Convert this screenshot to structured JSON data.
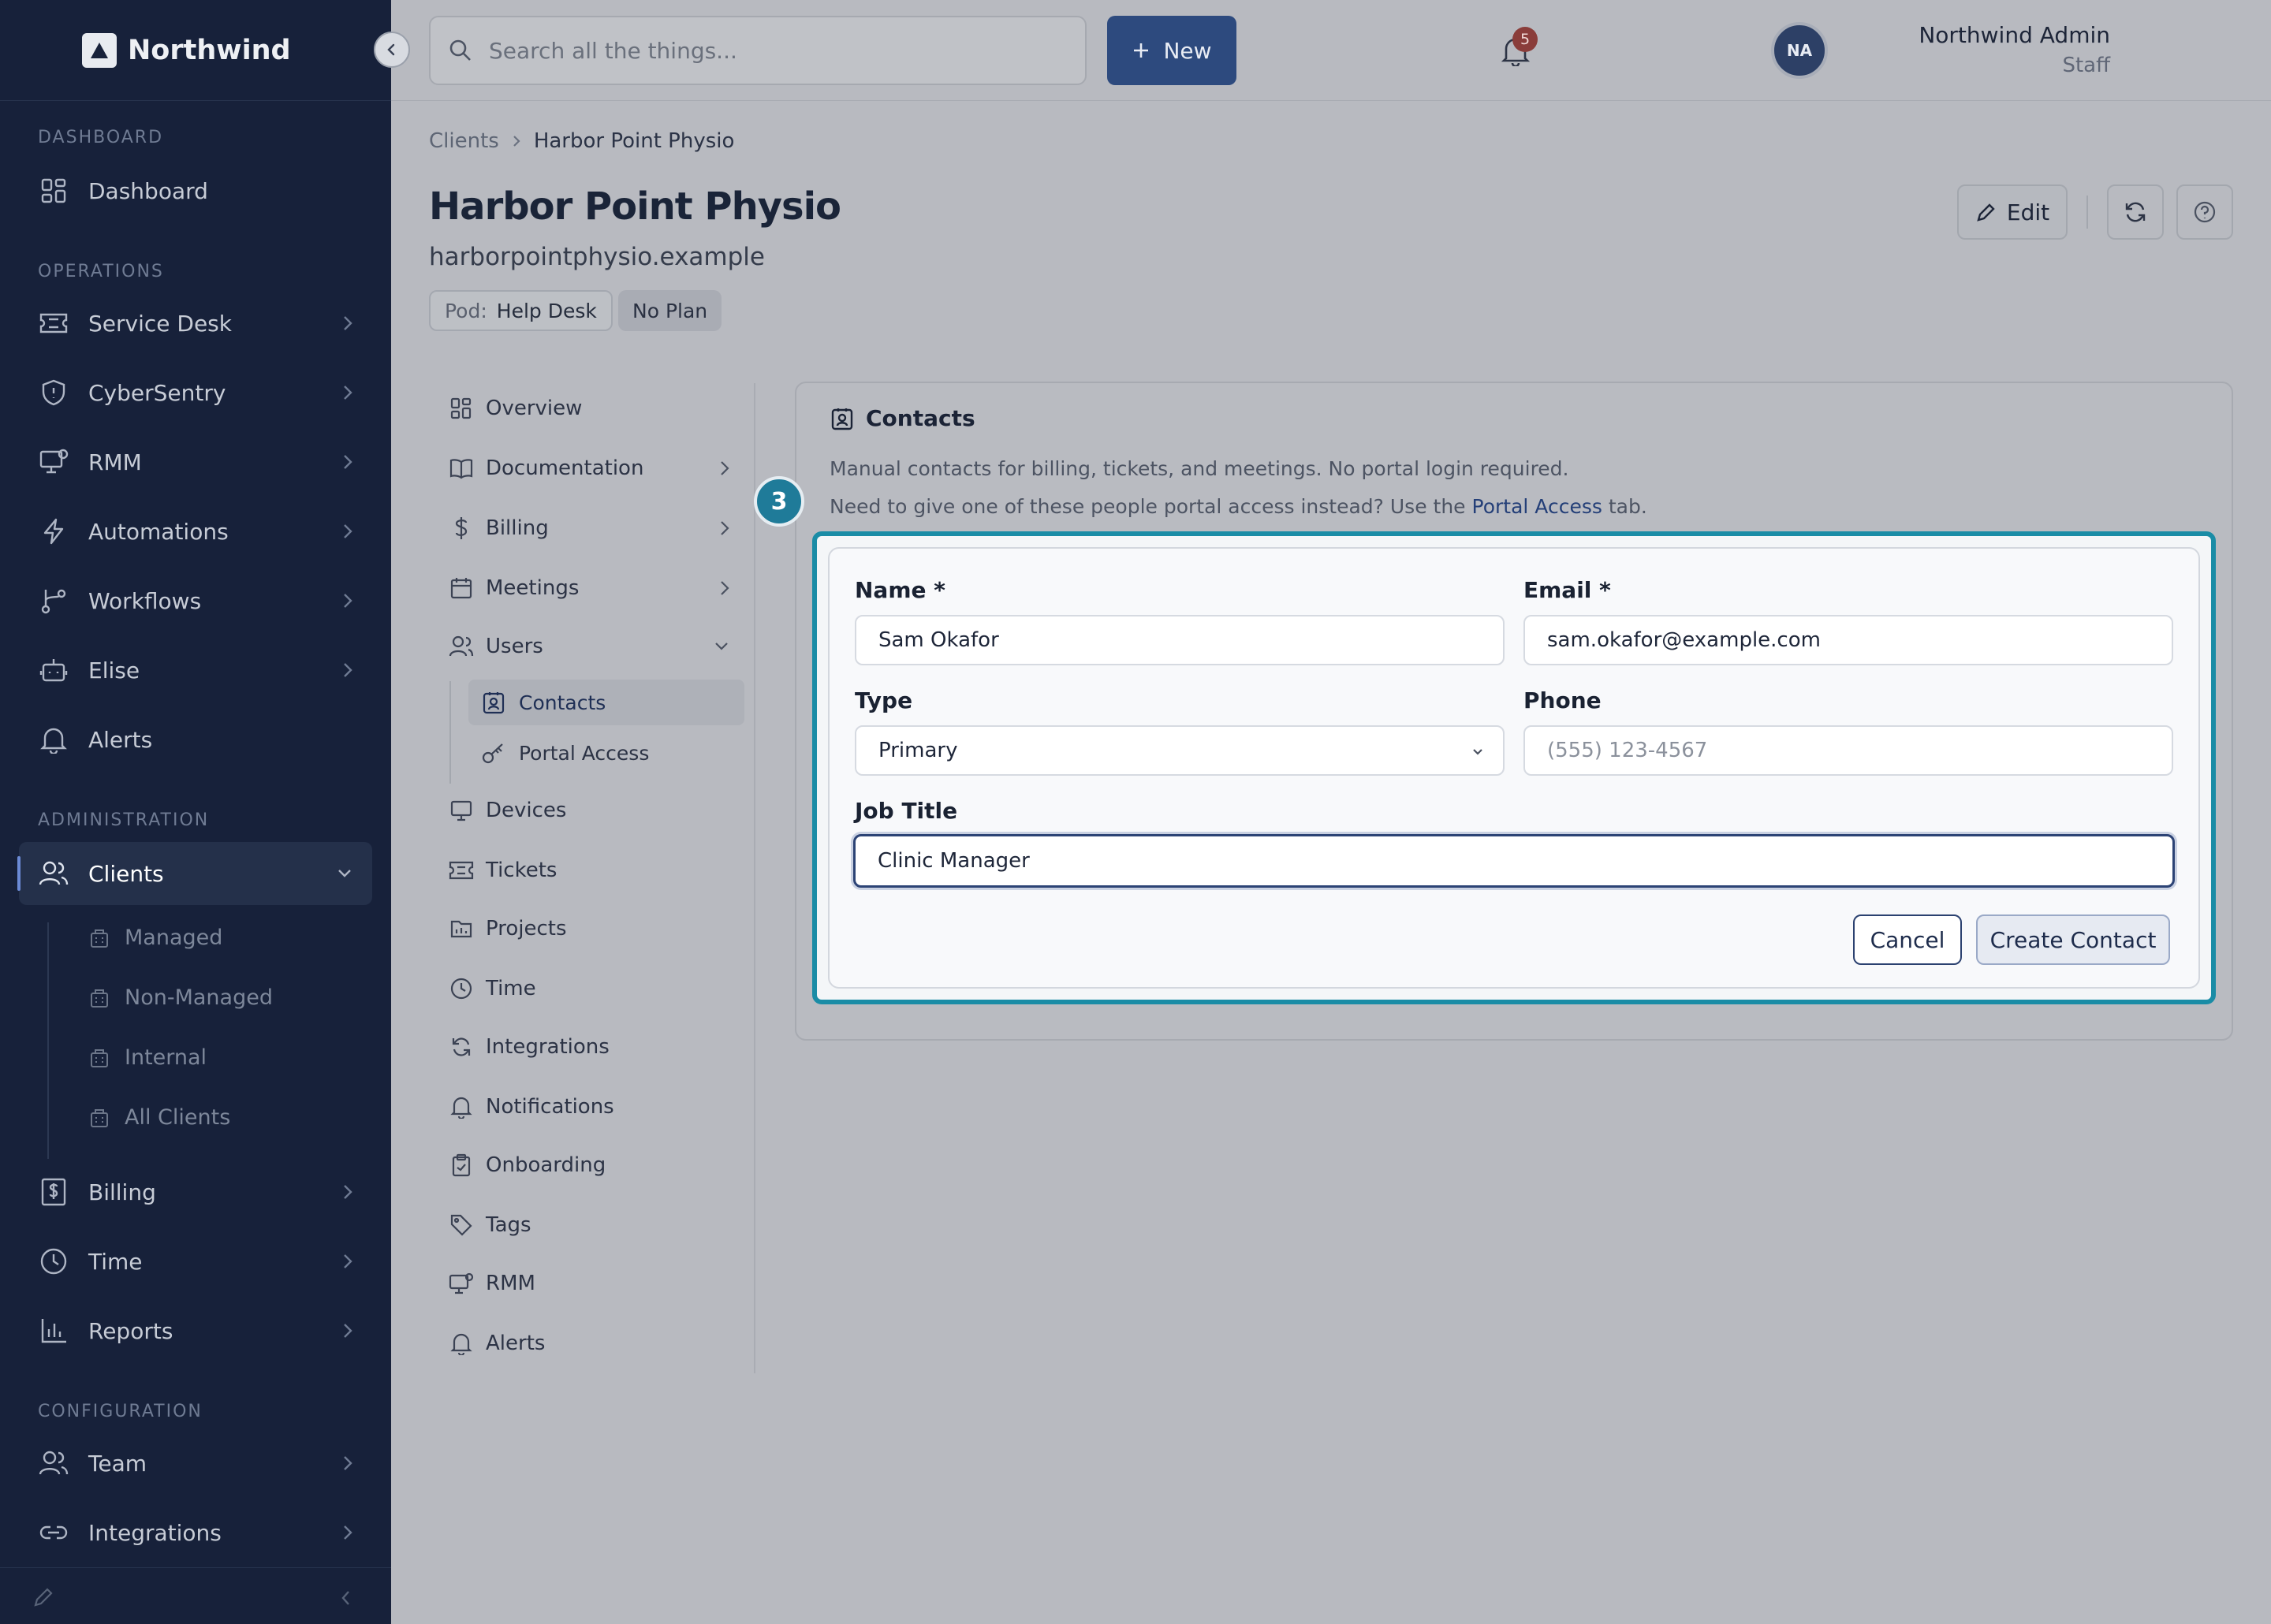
{
  "sidebar": {
    "brand": "Northwind",
    "sections": {
      "dashboard": "DASHBOARD",
      "operations": "OPERATIONS",
      "administration": "ADMINISTRATION",
      "configuration": "CONFIGURATION"
    },
    "items": {
      "dashboard": "Dashboard",
      "service_desk": "Service Desk",
      "cybersentry": "CyberSentry",
      "rmm": "RMM",
      "automations": "Automations",
      "workflows": "Workflows",
      "elise": "Elise",
      "alerts": "Alerts",
      "clients": "Clients",
      "billing": "Billing",
      "time": "Time",
      "reports": "Reports",
      "team": "Team",
      "integrations": "Integrations"
    },
    "client_subitems": [
      "Managed",
      "Non-Managed",
      "Internal",
      "All Clients"
    ]
  },
  "topbar": {
    "search_placeholder": "Search all the things...",
    "new_label": "New",
    "notification_count": "5",
    "user_name": "Northwind Admin",
    "user_role": "Staff",
    "avatar_initials": "NA"
  },
  "breadcrumb": {
    "parent": "Clients",
    "current": "Harbor Point Physio"
  },
  "client": {
    "title": "Harbor Point Physio",
    "domain": "harborpointphysio.example",
    "pod_label": "Pod:",
    "pod_value": "Help Desk",
    "plan": "No Plan",
    "edit_label": "Edit"
  },
  "subnav": {
    "overview": "Overview",
    "documentation": "Documentation",
    "billing": "Billing",
    "meetings": "Meetings",
    "users": "Users",
    "contacts": "Contacts",
    "portal_access": "Portal Access",
    "devices": "Devices",
    "tickets": "Tickets",
    "projects": "Projects",
    "time": "Time",
    "integrations": "Integrations",
    "notifications": "Notifications",
    "onboarding": "Onboarding",
    "tags": "Tags",
    "rmm": "RMM",
    "alerts": "Alerts"
  },
  "contacts": {
    "title": "Contacts",
    "desc1": "Manual contacts for billing, tickets, and meetings. No portal login required.",
    "desc2_pre": "Need to give one of these people portal access instead? Use the",
    "desc2_link": "Portal Access",
    "desc2_post": "tab.",
    "step_number": "3"
  },
  "form": {
    "name_label": "Name *",
    "name_value": "Sam Okafor",
    "email_label": "Email *",
    "email_value": "sam.okafor@example.com",
    "type_label": "Type",
    "type_value": "Primary",
    "phone_label": "Phone",
    "phone_placeholder": "(555) 123-4567",
    "job_label": "Job Title",
    "job_value": "Clinic Manager",
    "cancel_label": "Cancel",
    "create_label": "Create Contact"
  },
  "colors": {
    "sidebar": "#17213a",
    "accent": "#2d4a7e",
    "highlight": "#1a8ca6",
    "badge": "#8a3d3a"
  }
}
